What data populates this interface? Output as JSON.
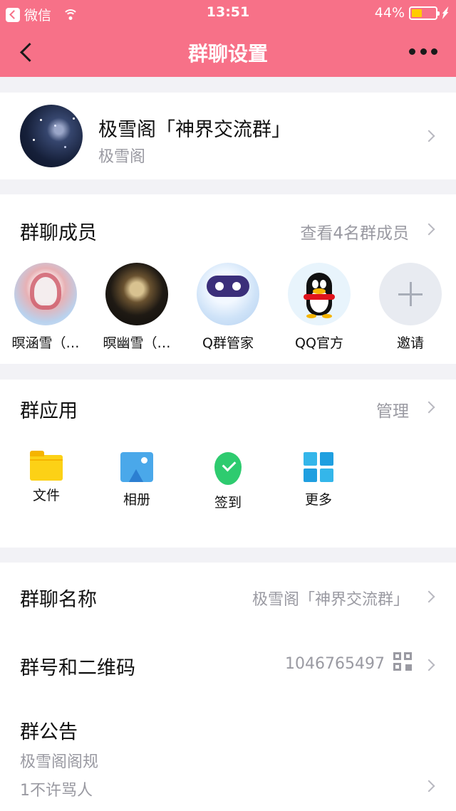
{
  "status_bar": {
    "carrier": "微信",
    "time": "13:51",
    "battery_percent": "44%",
    "battery_level": 0.44
  },
  "nav": {
    "title": "群聊设置"
  },
  "group": {
    "name": "极雪阁「神界交流群」",
    "subtitle": "极雪阁"
  },
  "members": {
    "title": "群聊成员",
    "view_all": "查看4名群成员",
    "list": [
      {
        "name": "暝涵雪（…"
      },
      {
        "name": "暝幽雪（…"
      },
      {
        "name": "Q群管家"
      },
      {
        "name": "QQ官方"
      },
      {
        "name": "邀请"
      }
    ]
  },
  "apps": {
    "title": "群应用",
    "manage": "管理",
    "items": [
      {
        "label": "文件",
        "icon": "folder-icon"
      },
      {
        "label": "相册",
        "icon": "photo-album-icon"
      },
      {
        "label": "签到",
        "icon": "check-in-icon"
      },
      {
        "label": "更多",
        "icon": "grid-more-icon"
      }
    ]
  },
  "settings": {
    "group_name_label": "群聊名称",
    "group_name_value": "极雪阁「神界交流群」",
    "group_number_label": "群号和二维码",
    "group_number_value": "1046765497",
    "notice_label": "群公告",
    "notice_lines": [
      "极雪阁阁规",
      "1不许骂人"
    ]
  },
  "colors": {
    "accent": "#f77188",
    "secondary_text": "#9a9aa2",
    "battery": "#ffcc00"
  }
}
